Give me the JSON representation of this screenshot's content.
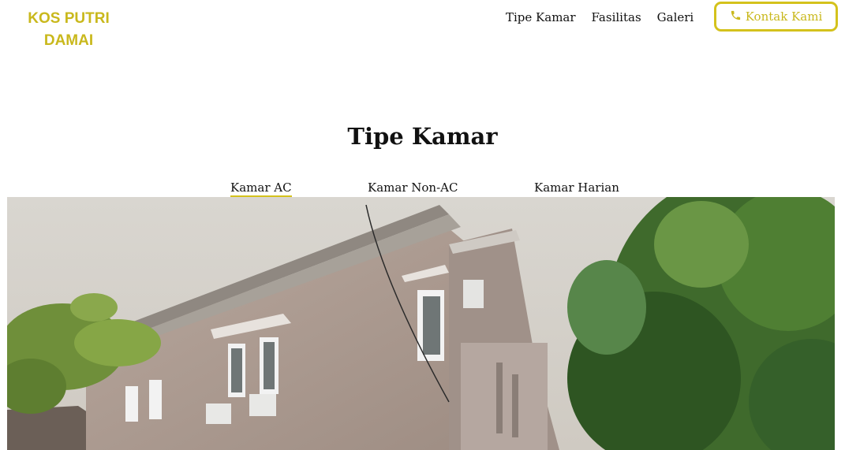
{
  "header": {
    "brand": "KOS PUTRI DAMAI",
    "nav": [
      {
        "label": "Tipe Kamar"
      },
      {
        "label": "Fasilitas"
      },
      {
        "label": "Galeri"
      }
    ],
    "contact_label": "Kontak Kami",
    "contact_icon": "phone-icon"
  },
  "main": {
    "section_title": "Tipe Kamar",
    "tabs": [
      {
        "label": "Kamar AC",
        "active": true
      },
      {
        "label": "Kamar Non-AC",
        "active": false
      },
      {
        "label": "Kamar Harian",
        "active": false
      }
    ],
    "photo_alt": "kost building photo"
  },
  "colors": {
    "accent": "#d4c21c",
    "brand_text": "#c9b81c",
    "text": "#111111"
  }
}
